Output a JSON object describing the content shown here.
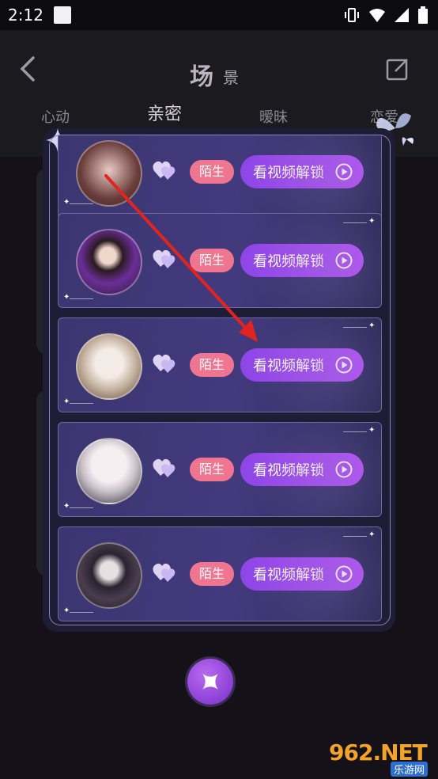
{
  "status_bar": {
    "time": "2:12"
  },
  "header": {
    "title_main": "场",
    "title_sub": "景",
    "tabs": [
      {
        "label": "心动"
      },
      {
        "label": "亲密"
      },
      {
        "label": "暧昧"
      },
      {
        "label": "恋爱"
      }
    ]
  },
  "rows": [
    {
      "badge": "陌生",
      "button": "看视频解锁"
    },
    {
      "badge": "陌生",
      "button": "看视频解锁"
    },
    {
      "badge": "陌生",
      "button": "看视频解锁"
    },
    {
      "badge": "陌生",
      "button": "看视频解锁"
    },
    {
      "badge": "陌生",
      "button": "看视频解锁"
    }
  ],
  "watermark": {
    "main": "962.NET",
    "sub": "乐游网"
  },
  "colors": {
    "accent": "#a44cee",
    "badge": "#f07590",
    "arrow": "#e0241f"
  }
}
